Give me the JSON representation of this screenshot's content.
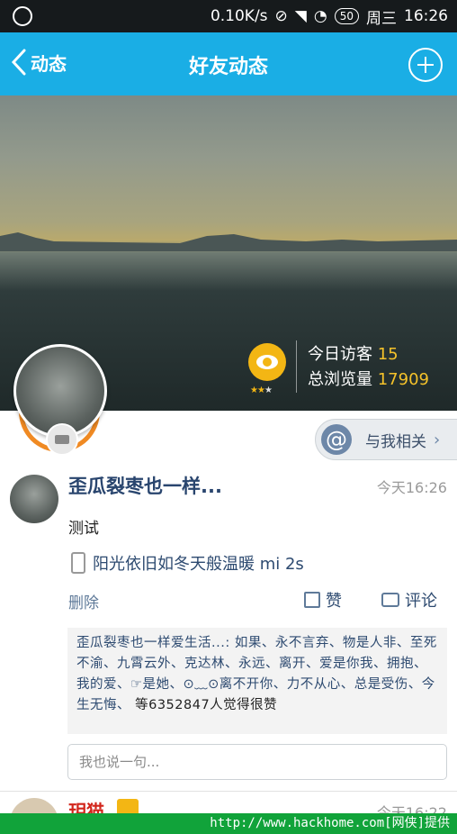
{
  "status_bar": {
    "speed": "0.10K/s",
    "battery": "50",
    "weekday": "周三",
    "time": "16:26"
  },
  "nav": {
    "back_label": "动态",
    "title": "好友动态"
  },
  "cover": {
    "visitors_today_label": "今日访客",
    "visitors_today": "15",
    "total_views_label": "总浏览量",
    "total_views": "17909",
    "rating_stars": 2
  },
  "about_me": {
    "label": "与我相关"
  },
  "post": {
    "name": "歪瓜裂枣也一样...",
    "time": "今天16:26",
    "text": "测试",
    "device": "阳光依旧如冬天般温暖 mi 2s",
    "delete_label": "删除",
    "like_label": "赞",
    "comment_label": "评论",
    "likes_text": "歪瓜裂枣也一样爱生活...: 如果、永不言弃、物是人非、至死不渝、九霄云外、克达林、永远、离开、爱是你我、拥抱、我的爱、☞是她、⊙﹏⊙离不开你、力不从心、总是受伤、今生无悔、",
    "likes_count": "等6352847人觉得很赞",
    "reply_placeholder": "我也说一句..."
  },
  "next_post": {
    "name": "玥猫",
    "time": "今天16:22"
  },
  "watermark": "http://www.hackhome.com[网侠]提供",
  "colors": {
    "nav_bg": "#1aaee5",
    "accent_orange": "#f3b614",
    "name_blue": "#29456e"
  }
}
